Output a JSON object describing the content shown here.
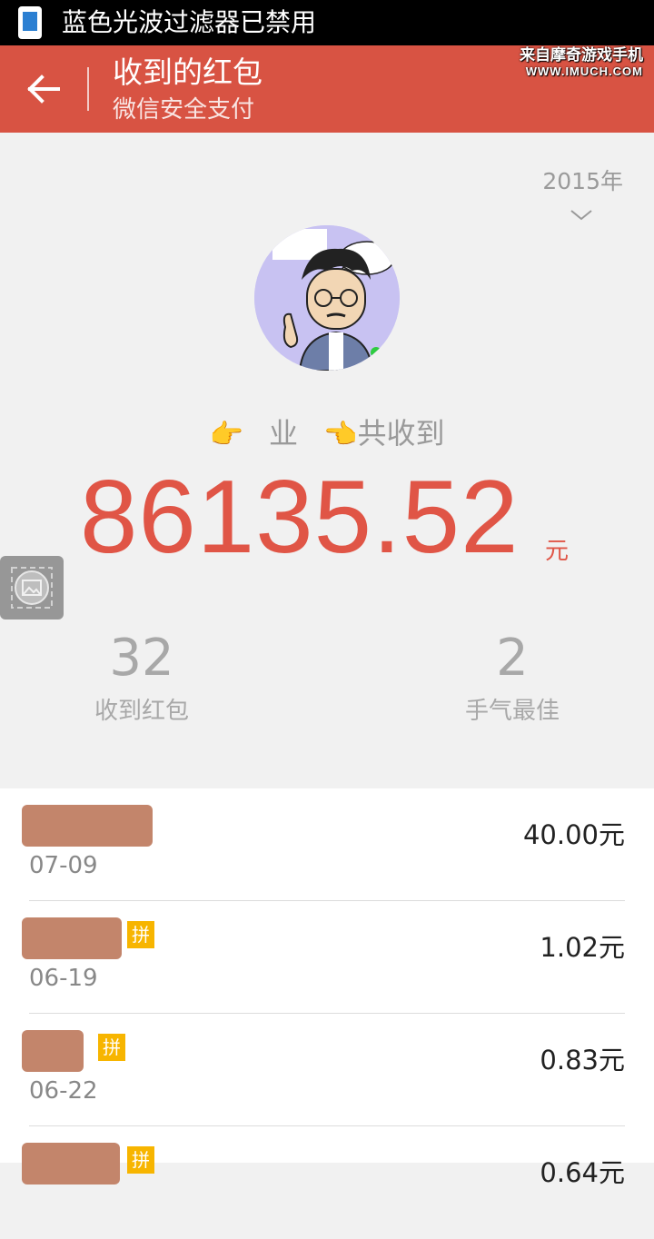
{
  "status_bar": {
    "text": "蓝色光波过滤器已禁用"
  },
  "app_bar": {
    "title": "收到的红包",
    "subtitle": "微信安全支付",
    "watermark_line1": "来自摩奇游戏手机",
    "watermark_line2": "WWW.IMUCH.COM"
  },
  "summary": {
    "year": "2015年",
    "name": "业",
    "received_label": "共收到",
    "total": "86135.52",
    "unit": "元"
  },
  "stats": [
    {
      "value": "32",
      "label": "收到红包"
    },
    {
      "value": "2",
      "label": "手气最佳"
    }
  ],
  "records": [
    {
      "date": "07-09",
      "amount": "40.00元",
      "pin": ""
    },
    {
      "date": "06-19",
      "amount": "1.02元",
      "pin": "拼"
    },
    {
      "date": "06-22",
      "amount": "0.83元",
      "pin": "拼"
    },
    {
      "date": "",
      "amount": "0.64元",
      "pin": "拼"
    }
  ],
  "colors": {
    "header": "#d85343",
    "amount": "#e05546",
    "pin_badge": "#f7b500"
  }
}
